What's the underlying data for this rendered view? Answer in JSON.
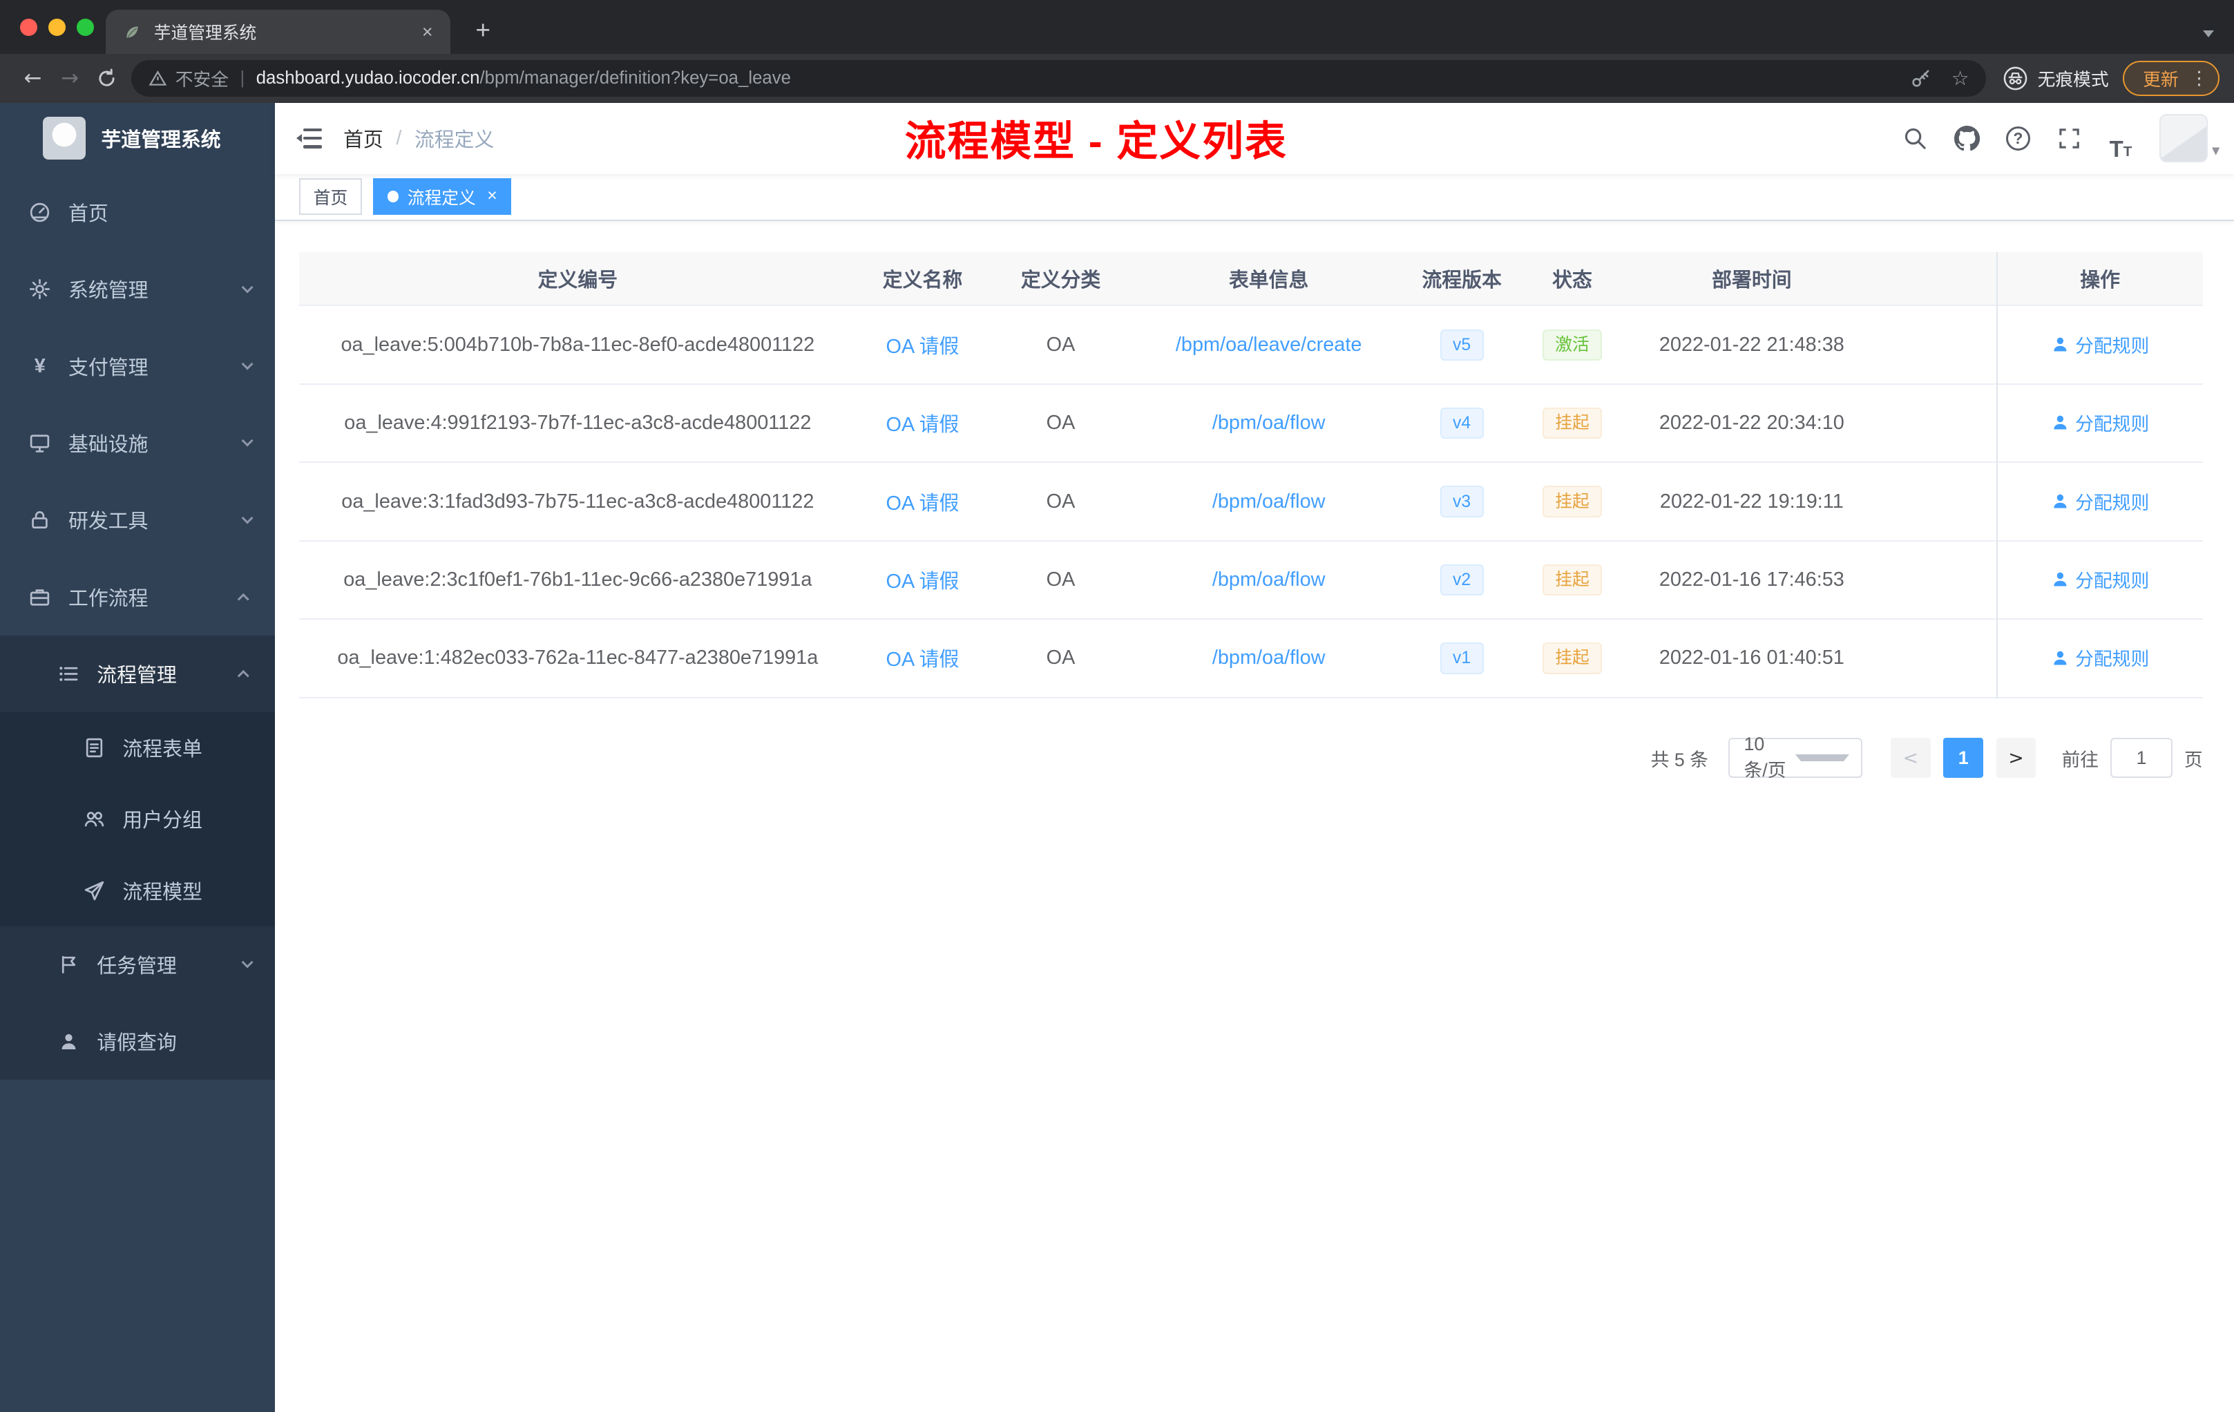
{
  "browser": {
    "tab_title": "芋道管理系统",
    "security_label": "不安全",
    "url_domain": "dashboard.yudao.iocoder.cn",
    "url_path": "/bpm/manager/definition?key=oa_leave",
    "incognito_label": "无痕模式",
    "update_label": "更新"
  },
  "sidebar": {
    "app_title": "芋道管理系统",
    "items": [
      {
        "label": "首页",
        "icon": "dashboard-icon"
      },
      {
        "label": "系统管理",
        "icon": "gear-icon"
      },
      {
        "label": "支付管理",
        "icon": "yen-icon"
      },
      {
        "label": "基础设施",
        "icon": "monitor-icon"
      },
      {
        "label": "研发工具",
        "icon": "lock-icon"
      },
      {
        "label": "工作流程",
        "icon": "briefcase-icon"
      },
      {
        "label": "流程管理",
        "icon": "list-icon"
      },
      {
        "label": "流程表单",
        "icon": "form-icon"
      },
      {
        "label": "用户分组",
        "icon": "users-icon"
      },
      {
        "label": "流程模型",
        "icon": "paper-plane-icon"
      },
      {
        "label": "任务管理",
        "icon": "flag-icon"
      },
      {
        "label": "请假查询",
        "icon": "user-icon"
      }
    ]
  },
  "header": {
    "breadcrumb": [
      "首页",
      "流程定义"
    ],
    "separator": "/",
    "banner": "流程模型 - 定义列表"
  },
  "tags": [
    {
      "label": "首页"
    },
    {
      "label": "流程定义"
    }
  ],
  "table": {
    "columns": [
      "定义编号",
      "定义名称",
      "定义分类",
      "表单信息",
      "流程版本",
      "状态",
      "部署时间",
      "操作"
    ],
    "rows": [
      {
        "id": "oa_leave:5:004b710b-7b8a-11ec-8ef0-acde48001122",
        "name": "OA 请假",
        "category": "OA",
        "form": "/bpm/oa/leave/create",
        "version": "v5",
        "status": "激活",
        "time": "2022-01-22 21:48:38",
        "action": "分配规则"
      },
      {
        "id": "oa_leave:4:991f2193-7b7f-11ec-a3c8-acde48001122",
        "name": "OA 请假",
        "category": "OA",
        "form": "/bpm/oa/flow",
        "version": "v4",
        "status": "挂起",
        "time": "2022-01-22 20:34:10",
        "action": "分配规则"
      },
      {
        "id": "oa_leave:3:1fad3d93-7b75-11ec-a3c8-acde48001122",
        "name": "OA 请假",
        "category": "OA",
        "form": "/bpm/oa/flow",
        "version": "v3",
        "status": "挂起",
        "time": "2022-01-22 19:19:11",
        "action": "分配规则"
      },
      {
        "id": "oa_leave:2:3c1f0ef1-76b1-11ec-9c66-a2380e71991a",
        "name": "OA 请假",
        "category": "OA",
        "form": "/bpm/oa/flow",
        "version": "v2",
        "status": "挂起",
        "time": "2022-01-16 17:46:53",
        "action": "分配规则"
      },
      {
        "id": "oa_leave:1:482ec033-762a-11ec-8477-a2380e71991a",
        "name": "OA 请假",
        "category": "OA",
        "form": "/bpm/oa/flow",
        "version": "v1",
        "status": "挂起",
        "time": "2022-01-16 01:40:51",
        "action": "分配规则"
      }
    ]
  },
  "pagination": {
    "total": "共 5 条",
    "page_size": "10条/页",
    "page": "1",
    "goto_label": "前往",
    "goto_value": "1",
    "unit_label": "页"
  },
  "colors": {
    "accent": "#409eff",
    "success": "#67c23a",
    "warning": "#e6a23c",
    "banner_red": "#ff0000",
    "sidebar_bg": "#304156"
  }
}
